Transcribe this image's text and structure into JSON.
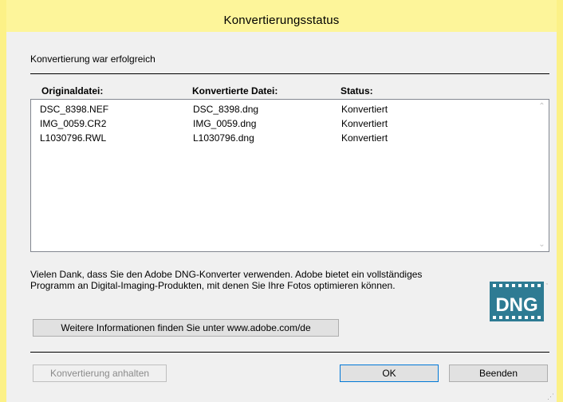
{
  "window": {
    "title": "Konvertierungsstatus"
  },
  "status": {
    "message": "Konvertierung war erfolgreich"
  },
  "table": {
    "columns": [
      "Originaldatei:",
      "Konvertierte Datei:",
      "Status:"
    ],
    "rows": [
      [
        "DSC_8398.NEF",
        "DSC_8398.dng",
        "Konvertiert"
      ],
      [
        "IMG_0059.CR2",
        "IMG_0059.dng",
        "Konvertiert"
      ],
      [
        "L1030796.RWL",
        "L1030796.dng",
        "Konvertiert"
      ]
    ]
  },
  "info": {
    "text_line1": "Vielen Dank, dass Sie den Adobe DNG-Konverter verwenden. Adobe bietet ein vollständiges",
    "text_line2": "Programm an Digital-Imaging-Produkten, mit denen Sie Ihre Fotos optimieren können.",
    "more_info_button": "Weitere Informationen finden Sie unter www.adobe.com/de",
    "logo_text": "DNG",
    "logo_icon": "dng-logo-icon"
  },
  "footer": {
    "stop_button": "Konvertierung anhalten",
    "ok_button": "OK",
    "exit_button": "Beenden"
  },
  "colors": {
    "title_bar": "#fdf59a",
    "logo_teal": "#2e7b93",
    "focus_border": "#0078d7"
  }
}
